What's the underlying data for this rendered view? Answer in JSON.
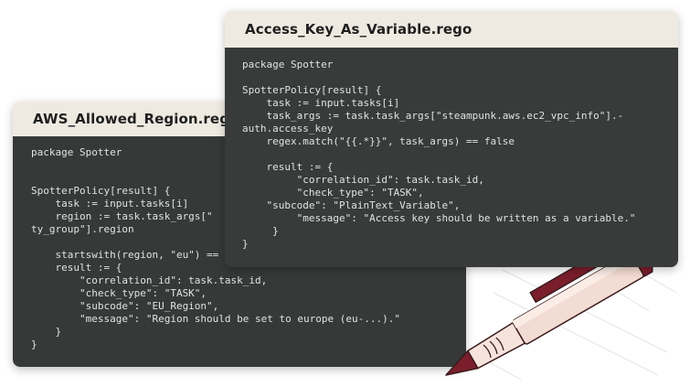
{
  "back_card": {
    "title": "AWS_Allowed_Region.rego",
    "code_lines": [
      "package Spotter",
      "",
      "",
      "SpotterPolicy[result] {",
      "    task := input.tasks[i]",
      "    region := task.task_args[\"",
      "ty_group\"].region",
      "",
      "    startswith(region, \"eu\") ==",
      "    result := {",
      "        \"correlation_id\": task.task_id,",
      "        \"check_type\": \"TASK\",",
      "        \"subcode\": \"EU_Region\",",
      "        \"message\": \"Region should be set to europe (eu-...).\"",
      "    }",
      "}"
    ]
  },
  "front_card": {
    "title": "Access_Key_As_Variable.rego",
    "code_lines": [
      "package Spotter",
      "",
      "SpotterPolicy[result] {",
      "    task := input.tasks[i]",
      "    task_args := task.task_args[\"steampunk.aws.ec2_vpc_info\"].-",
      "auth.access_key",
      "    regex.match(\"{{.*}}\", task_args) == false",
      "",
      "    result := {",
      "         \"correlation_id\": task.task_id,",
      "         \"check_type\": \"TASK\",",
      "    \"subcode\": \"PlainText_Variable\",",
      "         \"message\": \"Access key should be written as a variable.\"",
      "     }",
      "}"
    ]
  },
  "illustration": {
    "icon": "pen-icon",
    "colors": {
      "barrel": "#f3dcd3",
      "accent": "#7a1e2c",
      "outline": "#3a1a1d"
    }
  }
}
